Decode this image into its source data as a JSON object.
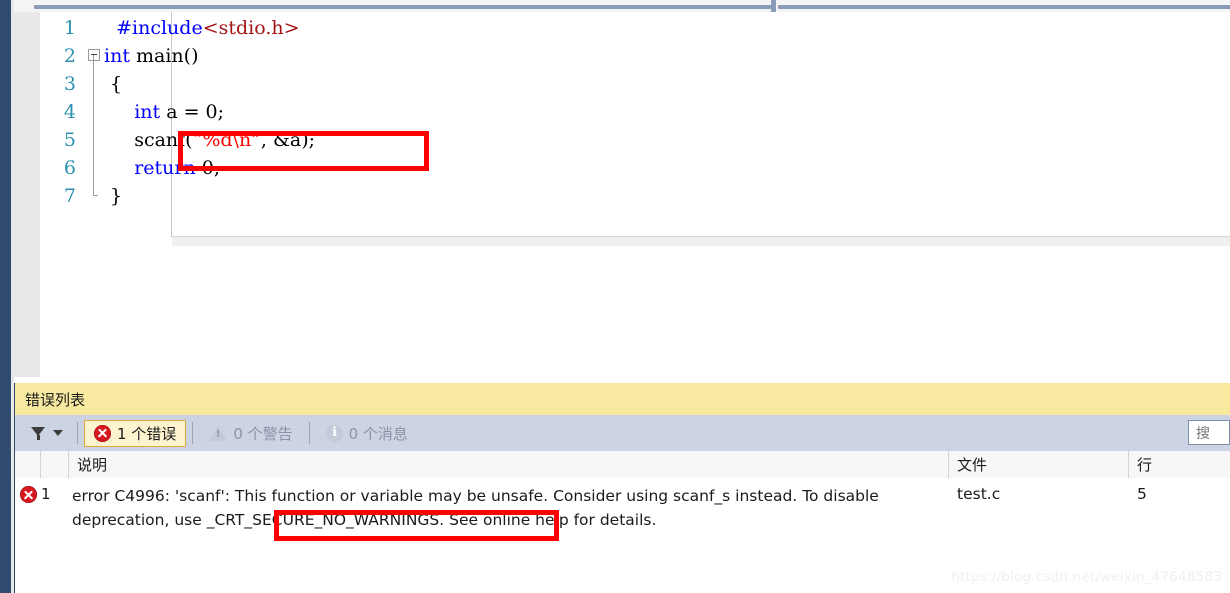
{
  "editor": {
    "code_lines": [
      {
        "num": "1",
        "fold": "none",
        "segments": [
          {
            "text": "  ",
            "cls": ""
          },
          {
            "text": "#include",
            "cls": "pre"
          },
          {
            "text": "<stdio.h>",
            "cls": "hdr"
          }
        ]
      },
      {
        "num": "2",
        "fold": "box",
        "segments": [
          {
            "text": "int",
            "cls": "kw"
          },
          {
            "text": " main()",
            "cls": ""
          }
        ]
      },
      {
        "num": "3",
        "fold": "line",
        "segments": [
          {
            "text": " {",
            "cls": ""
          }
        ]
      },
      {
        "num": "4",
        "fold": "line",
        "segments": [
          {
            "text": "     ",
            "cls": ""
          },
          {
            "text": "int",
            "cls": "kw"
          },
          {
            "text": " a = 0;",
            "cls": ""
          }
        ]
      },
      {
        "num": "5",
        "fold": "line",
        "segments": [
          {
            "text": "     scanf(",
            "cls": ""
          },
          {
            "text": "“%d\\n”",
            "cls": "str"
          },
          {
            "text": ", &a);",
            "cls": ""
          }
        ]
      },
      {
        "num": "6",
        "fold": "line",
        "segments": [
          {
            "text": "     ",
            "cls": ""
          },
          {
            "text": "return",
            "cls": "kw"
          },
          {
            "text": " 0;",
            "cls": ""
          }
        ]
      },
      {
        "num": "7",
        "fold": "endcap",
        "segments": [
          {
            "text": " }",
            "cls": ""
          }
        ]
      }
    ],
    "highlight_box_label": "scanf-line-highlight"
  },
  "error_list": {
    "title": "错误列表",
    "toolbar": {
      "filter_icon": "funnel-icon",
      "filter_caret": "chevron-down-icon",
      "errors": {
        "label": "1 个错误",
        "icon": "error-circle-icon",
        "active": true
      },
      "warnings": {
        "label": "0 个警告",
        "icon": "warning-triangle-icon",
        "active": false
      },
      "messages": {
        "label": "0 个消息",
        "icon": "info-circle-icon",
        "active": false
      },
      "search_placeholder": "搜索错误列表",
      "search_value": "搜"
    },
    "columns": {
      "description": "说明",
      "file": "文件",
      "line": "行"
    },
    "rows": [
      {
        "icon": "error-circle-icon",
        "number": "1",
        "description": "error C4996: 'scanf': This function or variable may be unsafe. Consider using scanf_s instead. To disable deprecation, use _CRT_SECURE_NO_WARNINGS. See online help for details.",
        "file": "test.c",
        "line": "5"
      }
    ],
    "highlight_box_label": "crt-secure-no-warnings-highlight"
  },
  "watermark": "https://blog.csdn.net/weixin_47648583",
  "colors": {
    "rail": "#2f4a6d",
    "title_bar": "#f7e9a0",
    "toolbar": "#ccd3e3",
    "active_button_bg": "#fdf3cf",
    "active_button_border": "#e0a93a",
    "error_red": "#d81920",
    "annotation_red": "#ff0000",
    "keyword_blue": "#0000ff",
    "header_dark_red": "#a31515",
    "string_red": "#ff0000",
    "line_number": "#2b91af"
  }
}
